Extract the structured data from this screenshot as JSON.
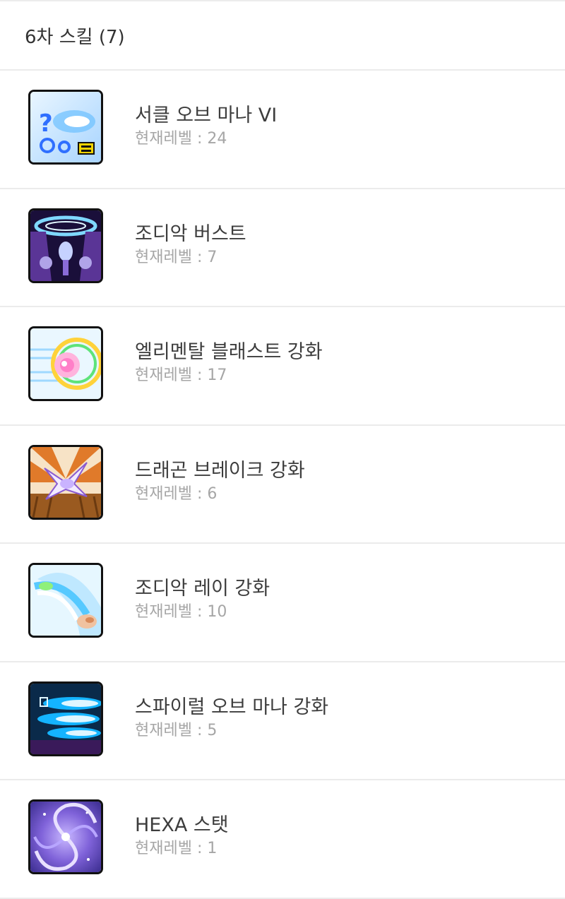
{
  "section": {
    "title": "6차 스킬 (7)"
  },
  "level_prefix": "현재레벨 : ",
  "skills": [
    {
      "name": "서클 오브 마나 VI",
      "level_text": "현재레벨 : 24",
      "level": 24,
      "icon": "circle-of-mana-icon",
      "colors": [
        "#cfe8ff",
        "#2f7dff",
        "#ffffff",
        "#f2d300"
      ]
    },
    {
      "name": "조디악 버스트",
      "level_text": "현재레벨 : 7",
      "level": 7,
      "icon": "zodiac-burst-icon",
      "colors": [
        "#1a0f3a",
        "#6a3fa8",
        "#7fd8ff",
        "#e8e0ff"
      ]
    },
    {
      "name": "엘리멘탈 블래스트 강화",
      "level_text": "현재레벨 : 17",
      "level": 17,
      "icon": "elemental-blast-icon",
      "colors": [
        "#eaf7ff",
        "#ff7fc8",
        "#ffd23a",
        "#5ee37a"
      ]
    },
    {
      "name": "드래곤 브레이크 강화",
      "level_text": "현재레벨 : 6",
      "level": 6,
      "icon": "dragon-break-icon",
      "colors": [
        "#c8742a",
        "#ffd6a0",
        "#f2eaff",
        "#8a5bd1"
      ]
    },
    {
      "name": "조디악 레이 강화",
      "level_text": "현재레벨 : 10",
      "level": 10,
      "icon": "zodiac-ray-icon",
      "colors": [
        "#d9f4ff",
        "#56c9ff",
        "#8ff07a",
        "#f0c2a0"
      ]
    },
    {
      "name": "스파이럴 오브 마나 강화",
      "level_text": "현재레벨 : 5",
      "level": 5,
      "icon": "spiral-of-mana-icon",
      "colors": [
        "#0a2a4a",
        "#14b4ff",
        "#dff6ff",
        "#3a1a5a"
      ]
    },
    {
      "name": "HEXA 스탯",
      "level_text": "현재레벨 : 1",
      "level": 1,
      "icon": "hexa-stat-icon",
      "colors": [
        "#3b2d8f",
        "#7f62d9",
        "#c9b8ff",
        "#ffffff"
      ]
    }
  ]
}
